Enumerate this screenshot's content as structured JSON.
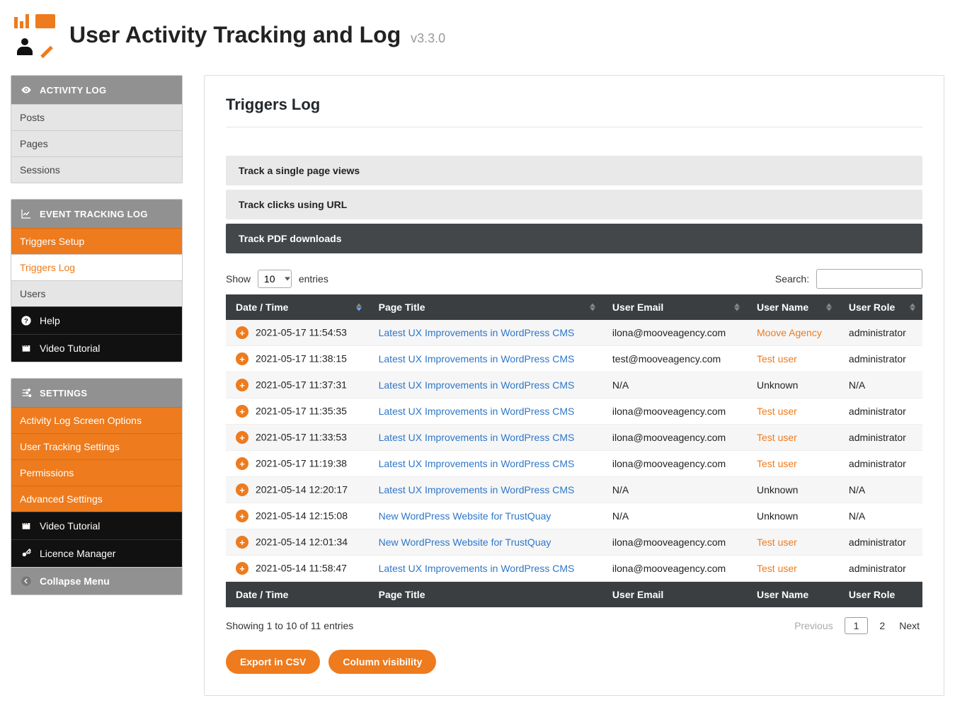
{
  "header": {
    "title": "User Activity Tracking and Log",
    "version": "v3.3.0"
  },
  "sidebar": {
    "activity": {
      "head": "ACTIVITY LOG",
      "items": [
        "Posts",
        "Pages",
        "Sessions"
      ]
    },
    "event": {
      "head": "EVENT TRACKING LOG",
      "items": [
        "Triggers Setup",
        "Triggers Log",
        "Users",
        "Help",
        "Video Tutorial"
      ]
    },
    "settings": {
      "head": "SETTINGS",
      "items": [
        "Activity Log Screen Options",
        "User Tracking Settings",
        "Permissions",
        "Advanced Settings",
        "Video Tutorial",
        "Licence Manager",
        "Collapse Menu"
      ]
    }
  },
  "content": {
    "title": "Triggers Log",
    "accordion": [
      "Track a single page views",
      "Track clicks using URL",
      "Track PDF downloads"
    ],
    "show_label_pre": "Show",
    "show_value": "10",
    "show_label_post": "entries",
    "search_label": "Search:",
    "columns": [
      "Date / Time",
      "Page Title",
      "User Email",
      "User Name",
      "User Role"
    ],
    "rows": [
      {
        "dt": "2021-05-17 11:54:53",
        "pt": "Latest UX Improvements in WordPress CMS",
        "ue": "ilona@mooveagency.com",
        "un": "Moove Agency",
        "ur": "administrator"
      },
      {
        "dt": "2021-05-17 11:38:15",
        "pt": "Latest UX Improvements in WordPress CMS",
        "ue": "test@mooveagency.com",
        "un": "Test user",
        "ur": "administrator"
      },
      {
        "dt": "2021-05-17 11:37:31",
        "pt": "Latest UX Improvements in WordPress CMS",
        "ue": "N/A",
        "un": "Unknown",
        "ur": "N/A"
      },
      {
        "dt": "2021-05-17 11:35:35",
        "pt": "Latest UX Improvements in WordPress CMS",
        "ue": "ilona@mooveagency.com",
        "un": "Test user",
        "ur": "administrator"
      },
      {
        "dt": "2021-05-17 11:33:53",
        "pt": "Latest UX Improvements in WordPress CMS",
        "ue": "ilona@mooveagency.com",
        "un": "Test user",
        "ur": "administrator"
      },
      {
        "dt": "2021-05-17 11:19:38",
        "pt": "Latest UX Improvements in WordPress CMS",
        "ue": "ilona@mooveagency.com",
        "un": "Test user",
        "ur": "administrator"
      },
      {
        "dt": "2021-05-14 12:20:17",
        "pt": "Latest UX Improvements in WordPress CMS",
        "ue": "N/A",
        "un": "Unknown",
        "ur": "N/A"
      },
      {
        "dt": "2021-05-14 12:15:08",
        "pt": "New WordPress Website for TrustQuay",
        "ue": "N/A",
        "un": "Unknown",
        "ur": "N/A"
      },
      {
        "dt": "2021-05-14 12:01:34",
        "pt": "New WordPress Website for TrustQuay",
        "ue": "ilona@mooveagency.com",
        "un": "Test user",
        "ur": "administrator"
      },
      {
        "dt": "2021-05-14 11:58:47",
        "pt": "Latest UX Improvements in WordPress CMS",
        "ue": "ilona@mooveagency.com",
        "un": "Test user",
        "ur": "administrator"
      }
    ],
    "footer_columns": [
      "Date / Time",
      "Page Title",
      "User Email",
      "User Name",
      "User Role"
    ],
    "info_text": "Showing 1 to 10 of 11 entries",
    "pagination": {
      "prev": "Previous",
      "pages": [
        "1",
        "2"
      ],
      "next": "Next",
      "active": "1"
    },
    "buttons": {
      "export": "Export in CSV",
      "colvis": "Column visibility"
    }
  }
}
